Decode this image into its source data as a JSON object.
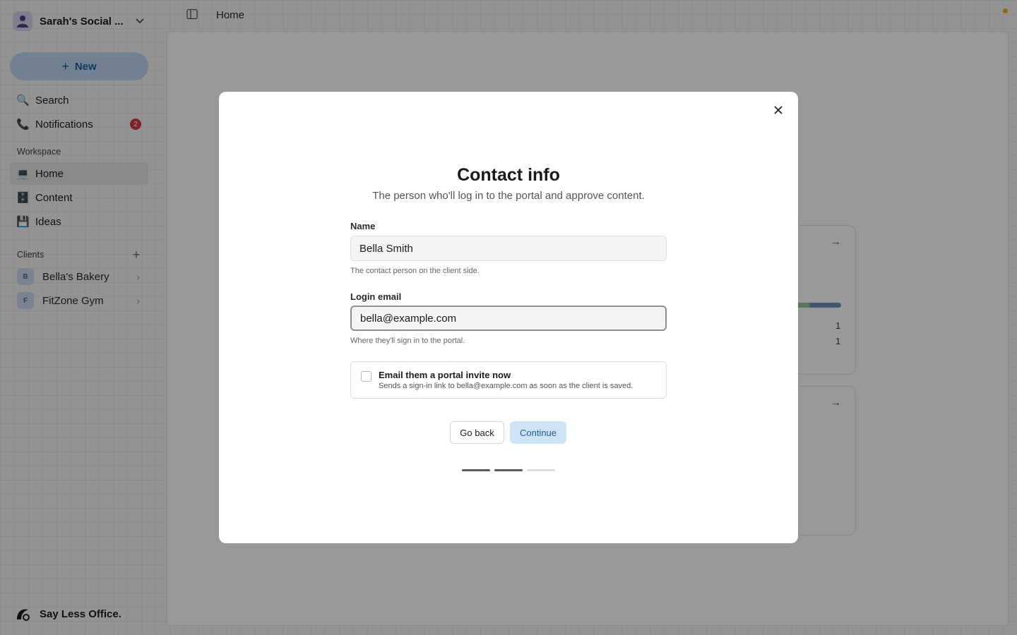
{
  "sidebar": {
    "workspace_name": "Sarah's Social ...",
    "new_label": "New",
    "search_label": "Search",
    "notifications_label": "Notifications",
    "notifications_count": "2",
    "workspace_section": "Workspace",
    "nav": [
      {
        "label": "Home",
        "icon": "laptop-icon",
        "active": true
      },
      {
        "label": "Content",
        "icon": "cabinet-icon",
        "active": false
      },
      {
        "label": "Ideas",
        "icon": "floppy-icon",
        "active": false
      }
    ],
    "clients_section": "Clients",
    "clients": [
      {
        "initial": "B",
        "name": "Bella's Bakery"
      },
      {
        "initial": "F",
        "name": "FitZone Gym"
      }
    ],
    "brand": "Say Less Office."
  },
  "topbar": {
    "breadcrumb": "Home"
  },
  "background_cards": {
    "stat_1": "1",
    "stat_2": "1"
  },
  "modal": {
    "title": "Contact info",
    "subtitle": "The person who'll log in to the portal and approve content.",
    "name_label": "Name",
    "name_value": "Bella Smith",
    "name_help": "The contact person on the client side.",
    "email_label": "Login email",
    "email_value": "bella@example.com",
    "email_help": "Where they'll sign in to the portal.",
    "invite_title": "Email them a portal invite now",
    "invite_desc": "Sends a sign-in link to bella@example.com as soon as the client is saved.",
    "invite_checked": false,
    "back_label": "Go back",
    "continue_label": "Continue",
    "step_current": 2,
    "step_total": 3
  },
  "colors": {
    "accent": "#1f5e9c",
    "accent_bg": "#bcd7f2",
    "badge": "#d33a4a",
    "status_dot": "#e6b400"
  }
}
